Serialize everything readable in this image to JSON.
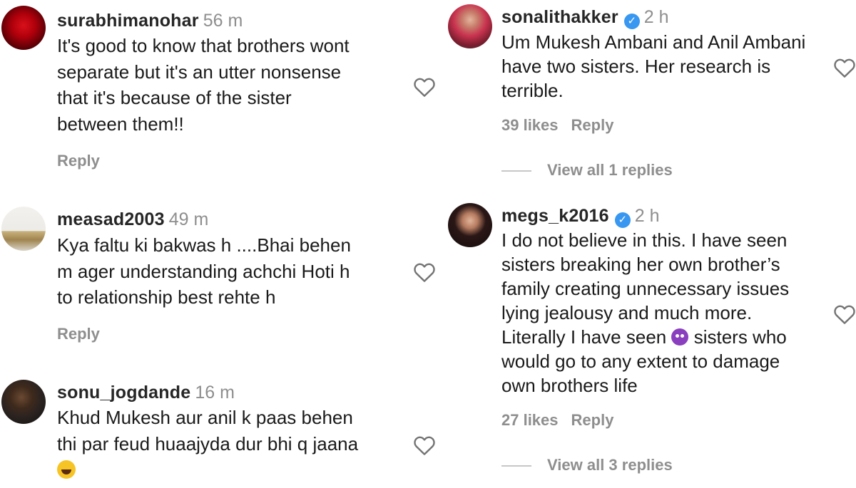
{
  "left_column": [
    {
      "username": "surabhimanohar",
      "time": "56 m",
      "avatar": "red-rose-avatar",
      "lines": [
        "It's good to know that brothers wont",
        "separate but it's an utter nonsense",
        "that it's because of the sister",
        "between them!!"
      ],
      "reply_label": "Reply"
    },
    {
      "username": "measad2003",
      "time": "49 m",
      "avatar": "temple-avatar",
      "lines": [
        "Kya faltu ki bakwas h ....Bhai behen",
        "m ager understanding achchi Hoti h",
        "to relationship best rehte h"
      ],
      "reply_label": "Reply"
    },
    {
      "username": "sonu_jogdande",
      "time": "16 m",
      "avatar": "selfie-avatar",
      "lines": [
        "Khud Mukesh aur anil k paas behen",
        "thi par feud huaajyda dur bhi q jaana"
      ],
      "emoji": "face-with-tears-of-joy"
    }
  ],
  "right_column": [
    {
      "username": "sonalithakker",
      "verified": true,
      "time": "2 h",
      "avatar": "woman-pink-outfit-avatar",
      "lines": [
        "Um Mukesh Ambani and Anil Ambani",
        "have two sisters. Her research is",
        "terrible."
      ],
      "likes": "39 likes",
      "reply_label": "Reply",
      "view_replies": "View all 1 replies"
    },
    {
      "username": "megs_k2016",
      "verified": true,
      "time": "2 h",
      "avatar": "woman-portrait-avatar",
      "lines": [
        "I do not believe in this. I have seen",
        "sisters breaking her own brother’s",
        "family creating unnecessary issues",
        "lying jealousy and much more.",
        "Literally I have seen",
        "sisters who",
        "would go to any extent to damage",
        "own brothers life"
      ],
      "emoji": "smiling-face-with-horns",
      "likes": "27 likes",
      "reply_label": "Reply",
      "view_replies": "View all 3 replies"
    }
  ],
  "icons": {
    "heart": "heart-outline-icon",
    "verified": "verified-badge-icon"
  },
  "colors": {
    "username": "#262626",
    "secondary": "#8e8e8e",
    "verified": "#3897f0"
  }
}
